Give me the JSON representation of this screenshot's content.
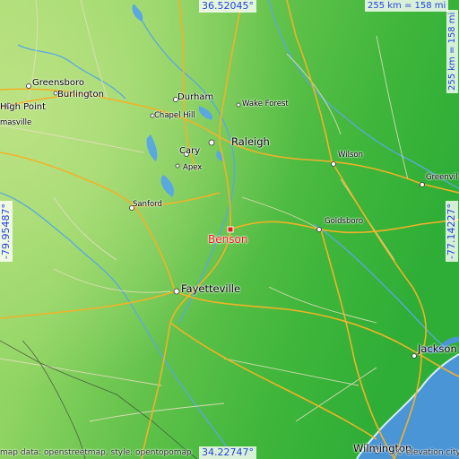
{
  "map": {
    "target": "Benson",
    "colors": {
      "land_low": "#37b63a",
      "land_high": "#9ed96a",
      "ocean": "#4a95d6",
      "road_major": "#f2b227",
      "road_minor": "#dcd8ba",
      "water": "#5aa8e0",
      "target_marker": "#ee1b1b",
      "coord_text": "#2244dd"
    },
    "coords": {
      "top": "36.52045°",
      "bottom": "34.22747°",
      "left": "-79.95487°",
      "right": "-77.14227°"
    },
    "scale": {
      "horizontal": "255 km = 158 mi",
      "vertical": "255 km = 158 mi"
    },
    "cities": [
      {
        "name": "Greensboro"
      },
      {
        "name": "Burlington"
      },
      {
        "name": "High Point"
      },
      {
        "name": "masville"
      },
      {
        "name": "Durham"
      },
      {
        "name": "Wake Forest"
      },
      {
        "name": "Chapel Hill"
      },
      {
        "name": "Raleigh"
      },
      {
        "name": "Cary"
      },
      {
        "name": "Apex"
      },
      {
        "name": "Wilson"
      },
      {
        "name": "Greenvil"
      },
      {
        "name": "Sanford"
      },
      {
        "name": "Goldsboro"
      },
      {
        "name": "Benson"
      },
      {
        "name": "Fayetteville"
      },
      {
        "name": "Jackson"
      },
      {
        "name": "Wilmington"
      }
    ],
    "credits": {
      "left": "map data: openstreetmap, style: opentopomap",
      "right": "© elevation.city"
    }
  }
}
